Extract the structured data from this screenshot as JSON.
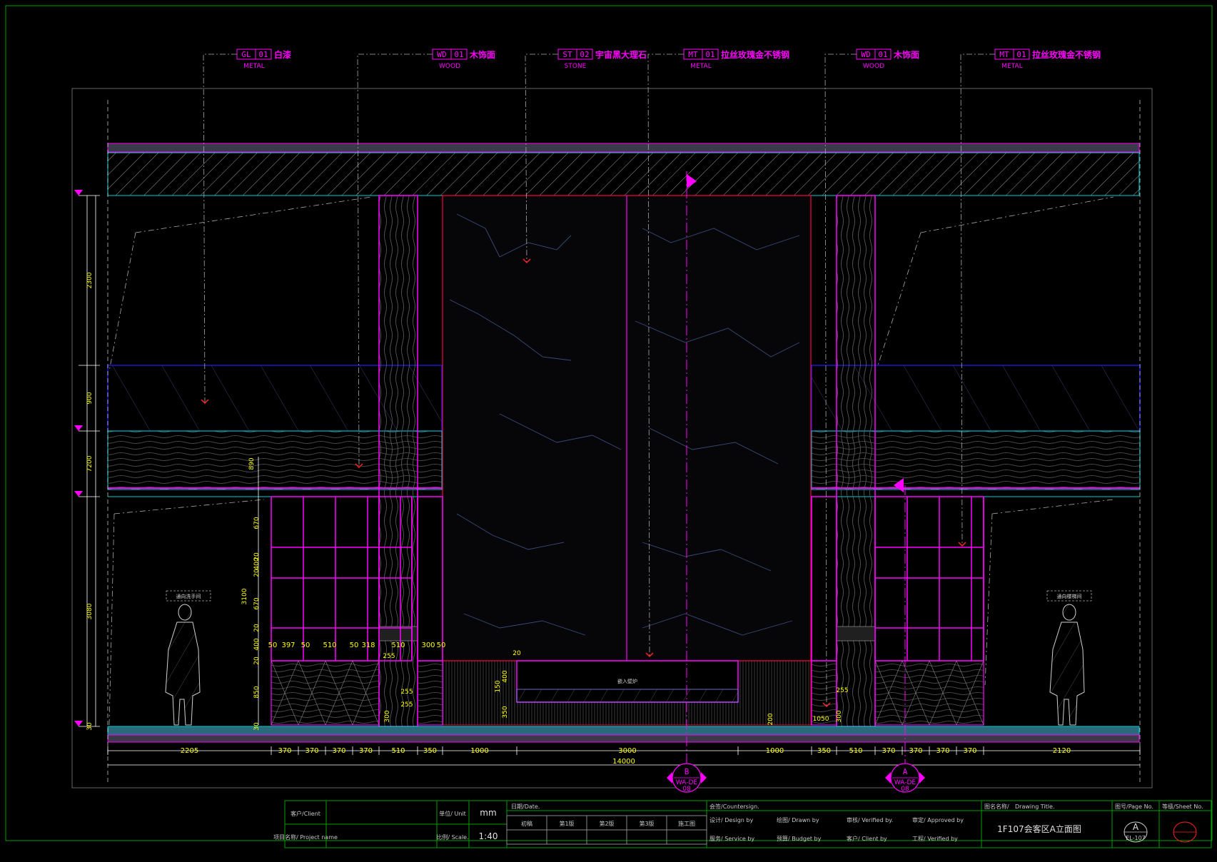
{
  "callouts": [
    {
      "code": "GL",
      "num": "01",
      "name": "白漆",
      "category": "METAL"
    },
    {
      "code": "WD",
      "num": "01",
      "name": "木饰面",
      "category": "WOOD"
    },
    {
      "code": "ST",
      "num": "02",
      "name": "宇宙黑大理石",
      "category": "STONE"
    },
    {
      "code": "MT",
      "num": "01",
      "name": "拉丝玫瑰金不锈钢",
      "category": "METAL"
    },
    {
      "code": "WD",
      "num": "01",
      "name": "木饰面",
      "category": "WOOD"
    },
    {
      "code": "MT",
      "num": "01",
      "name": "拉丝玫瑰金不锈钢",
      "category": "METAL"
    }
  ],
  "left_dims": [
    "2300",
    "900",
    "7200",
    "3080",
    "30"
  ],
  "inner_dims": [
    "890",
    "670",
    "20",
    "400",
    "20",
    "670",
    "20",
    "3100",
    "400",
    "20",
    "850",
    "30"
  ],
  "cabinet_dims": [
    "50",
    "397",
    "50",
    "510",
    "50",
    "318",
    "510",
    "300",
    "50"
  ],
  "center_dims": [
    "20",
    "150",
    "400",
    "350",
    "255",
    "255",
    "255",
    "300",
    "255",
    "200",
    "300",
    "1050"
  ],
  "bottom_dims": [
    "2205",
    "370",
    "370",
    "370",
    "370",
    "510",
    "350",
    "1000",
    "3000",
    "1000",
    "350",
    "510",
    "370",
    "370",
    "370",
    "370",
    "2120"
  ],
  "total_dim": "14000",
  "section_markers": [
    {
      "letter": "B",
      "ref": "WA-DE",
      "sheet": "08"
    },
    {
      "letter": "A",
      "ref": "WA-DE",
      "sheet": "08"
    }
  ],
  "notes": {
    "left": "通向洗手间",
    "right": "通向楼梯间",
    "fireplace": "嵌入壁炉"
  },
  "title_block": {
    "client_label": "客户/Client",
    "project_label": "项目名称/ Project name",
    "unit_label": "单位/ Unit",
    "unit_value": "mm",
    "scale_label": "比例/ Scale.",
    "scale_value": "1:40",
    "date_label": "日期/Date.",
    "stages": [
      "初稿",
      "第1版",
      "第2版",
      "第3版",
      "施工图"
    ],
    "countersign_label": "会签/Countersign.",
    "design_by": "设计/ Design by",
    "drawn_by": "绘图/ Drawn by",
    "verified_by": "审核/ Verified by.",
    "approved_by": "审定/ Approved by",
    "service_by": "服务/ Service by",
    "budget_by": "预算/ Budget by",
    "client_by": "客户/ Client by",
    "verified_by2": "工程/ Verified by",
    "drawing_title_label": "图名名称/",
    "drawing_title_label_en": "Drawing Title.",
    "drawing_title": "1F107会客区A立面图",
    "page_label": "图号/Page No.",
    "page_letter": "A",
    "page_no": "EL-107",
    "sheet_label": "等级/Sheet No."
  }
}
